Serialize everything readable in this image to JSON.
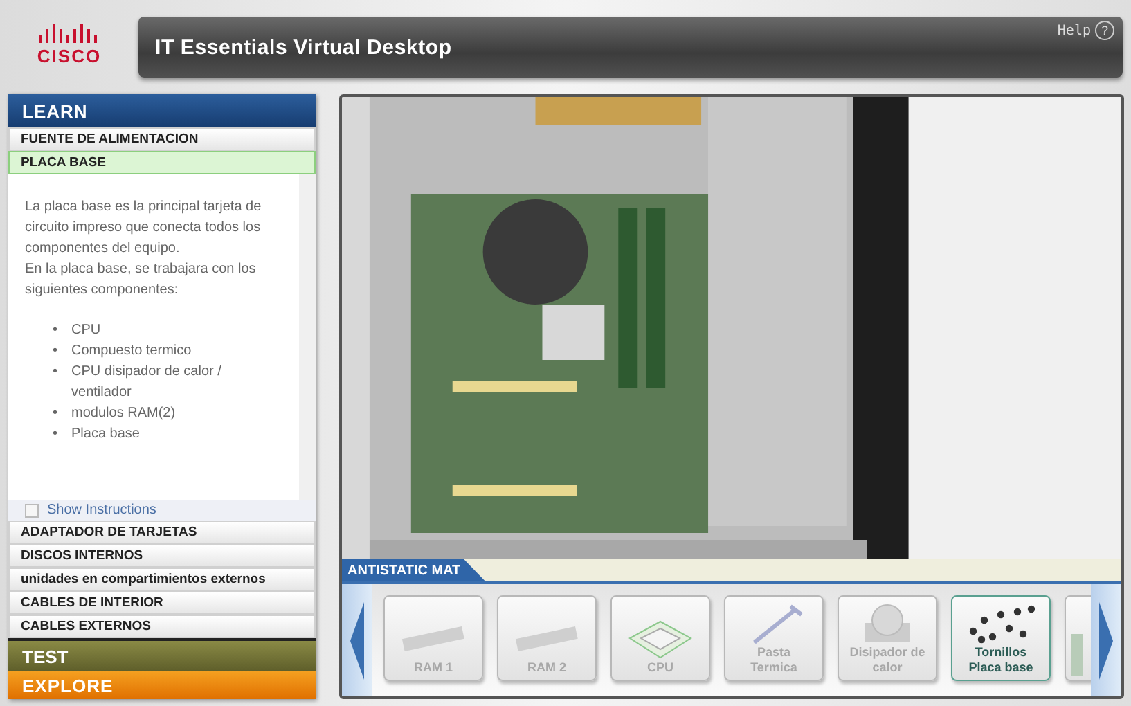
{
  "header": {
    "logo": "CISCO",
    "title": "IT Essentials Virtual Desktop",
    "help": "Help",
    "help_icon": "?"
  },
  "sidebar": {
    "learn": "LEARN",
    "items": [
      {
        "label": "FUENTE DE ALIMENTACION",
        "selected": false
      },
      {
        "label": "PLACA BASE",
        "selected": true
      }
    ],
    "description": [
      "La placa base es la principal tarjeta de circuito impreso que conecta todos los componentes del equipo.",
      "En la placa base, se trabajara con los siguientes componentes:"
    ],
    "bullet": "•",
    "components": [
      "CPU",
      "Compuesto termico",
      "CPU disipador de calor / ventilador",
      "modulos RAM(2)",
      "Placa base"
    ],
    "show_instructions": {
      "label": "Show Instructions",
      "checked": false
    },
    "more_items": [
      {
        "label": "ADAPTADOR DE TARJETAS",
        "selected": false
      },
      {
        "label": "DISCOS INTERNOS",
        "selected": false
      },
      {
        "label": "unidades en compartimientos externos",
        "selected": false
      },
      {
        "label": "CABLES DE INTERIOR",
        "selected": false
      },
      {
        "label": "CABLES EXTERNOS",
        "selected": false
      }
    ],
    "test": "TEST",
    "explore": "EXPLORE"
  },
  "viewer": {
    "mat_label": "ANTISTATIC MAT",
    "tray": [
      {
        "kind": "ram",
        "label": "RAM 1",
        "enabled": false
      },
      {
        "kind": "ram",
        "label": "RAM 2",
        "enabled": false
      },
      {
        "kind": "cpu",
        "label": "CPU",
        "enabled": false
      },
      {
        "kind": "paste",
        "label": "Pasta Termica",
        "enabled": false
      },
      {
        "kind": "cooler",
        "label": "Disipador de calor",
        "enabled": false
      },
      {
        "kind": "screws",
        "label": "Tornillos Placa base",
        "enabled": true
      },
      {
        "kind": "card",
        "enabled": false
      }
    ]
  }
}
